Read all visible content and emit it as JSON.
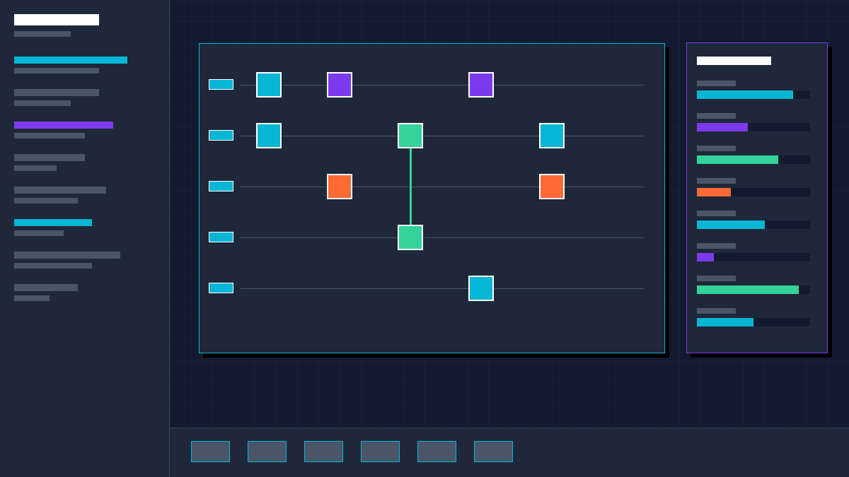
{
  "colors": {
    "background": "#111a2e",
    "panel": "#1f283a",
    "muted": "#4a5568",
    "cyan": "#06b6d4",
    "purple": "#7c3aed",
    "green": "#34d399",
    "orange": "#ff6b35",
    "white": "#ffffff"
  },
  "sidebar": {
    "items": [
      {
        "accent": "#06b6d4"
      },
      {
        "accent": "#4a5568"
      },
      {
        "accent": "#7c3aed"
      },
      {
        "accent": "#4a5568"
      },
      {
        "accent": "#4a5568"
      },
      {
        "accent": "#06b6d4"
      },
      {
        "accent": "#4a5568"
      },
      {
        "accent": "#4a5568"
      }
    ]
  },
  "circuit": {
    "wires": 5,
    "gates": [
      {
        "wire": 0,
        "step": 0,
        "color": "#06b6d4"
      },
      {
        "wire": 0,
        "step": 1,
        "color": "#7c3aed"
      },
      {
        "wire": 0,
        "step": 3,
        "color": "#7c3aed"
      },
      {
        "wire": 1,
        "step": 0,
        "color": "#06b6d4"
      },
      {
        "wire": 1,
        "step": 2,
        "color": "#34d399"
      },
      {
        "wire": 1,
        "step": 4,
        "color": "#06b6d4"
      },
      {
        "wire": 2,
        "step": 1,
        "color": "#ff6b35"
      },
      {
        "wire": 2,
        "step": 4,
        "color": "#ff6b35"
      },
      {
        "wire": 3,
        "step": 2,
        "color": "#34d399"
      },
      {
        "wire": 4,
        "step": 3,
        "color": "#06b6d4"
      }
    ],
    "connections": [
      {
        "from_wire": 1,
        "to_wire": 3,
        "step": 2,
        "color": "#34d399"
      }
    ]
  },
  "panel": {
    "meters": [
      {
        "level": 0.85,
        "color": "#06b6d4"
      },
      {
        "level": 0.45,
        "color": "#7c3aed"
      },
      {
        "level": 0.72,
        "color": "#34d399"
      },
      {
        "level": 0.3,
        "color": "#ff6b35"
      },
      {
        "level": 0.6,
        "color": "#06b6d4"
      },
      {
        "level": 0.15,
        "color": "#7c3aed"
      },
      {
        "level": 0.9,
        "color": "#34d399"
      },
      {
        "level": 0.5,
        "color": "#06b6d4"
      }
    ]
  },
  "toolbar": {
    "buttons": 6
  }
}
